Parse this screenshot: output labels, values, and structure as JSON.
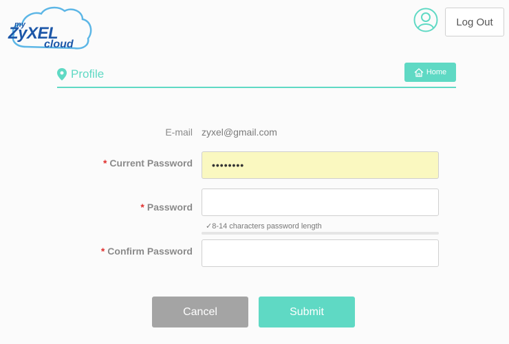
{
  "logo": {
    "my": "my",
    "brand": "ZyXEL",
    "cloud": "cloud"
  },
  "header": {
    "logout_label": "Log Out"
  },
  "section": {
    "title": "Profile",
    "home_label": "Home"
  },
  "form": {
    "email_label": "E-mail",
    "email_value": "zyxel@gmail.com",
    "required_mark": "*",
    "current_password_label": "Current Password",
    "current_password_value": "••••••••",
    "password_label": "Password",
    "password_value": "",
    "password_hint": "✓8-14 characters password length",
    "confirm_password_label": "Confirm Password",
    "confirm_password_value": ""
  },
  "actions": {
    "cancel_label": "Cancel",
    "submit_label": "Submit"
  },
  "colors": {
    "accent": "#5fd9c4",
    "brand": "#1d57a8",
    "required": "#e0312f",
    "autofill": "#faf8c0",
    "cancel": "#a4a4a4"
  }
}
